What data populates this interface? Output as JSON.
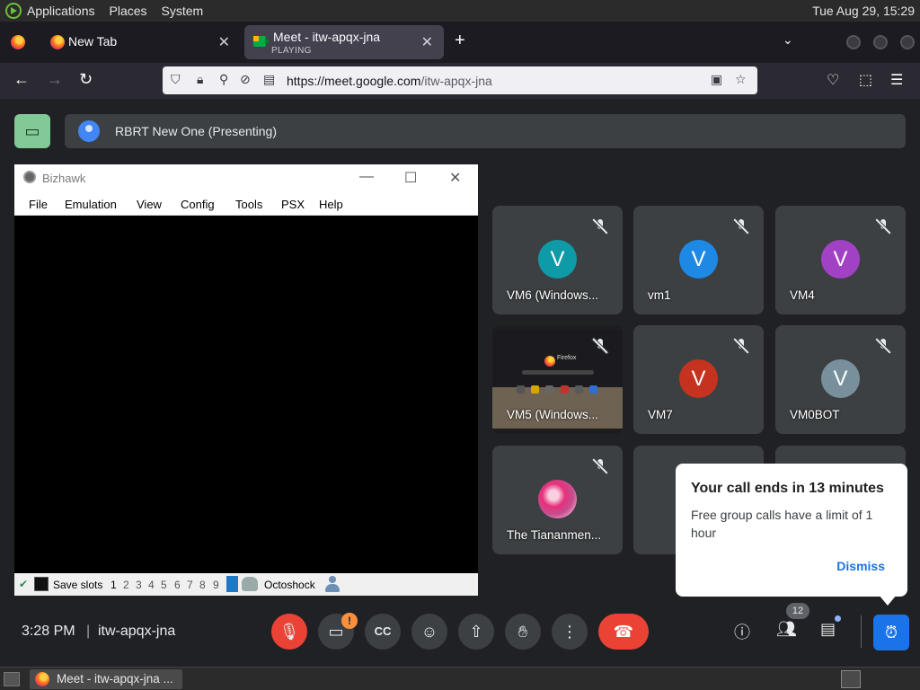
{
  "top_panel": {
    "menus": [
      "Applications",
      "Places",
      "System"
    ],
    "clock": "Tue Aug 29, 15:29"
  },
  "browser": {
    "tabs": [
      {
        "title": "New Tab",
        "subtitle": ""
      },
      {
        "title": "Meet - itw-apqx-jna",
        "subtitle": "PLAYING"
      }
    ],
    "url_domain_prefix": "https://meet.",
    "url_host": "google.com",
    "url_path": "/itw-apqx-jna"
  },
  "meet": {
    "presenter_label": "RBRT New One (Presenting)",
    "presented_window": {
      "title": "Bizhawk",
      "menu": [
        "File",
        "Emulation",
        "View",
        "Config",
        "Tools",
        "PSX",
        "Help"
      ],
      "status": {
        "save_slots_label": "Save slots",
        "slots": [
          "1",
          "2",
          "3",
          "4",
          "5",
          "6",
          "7",
          "8",
          "9"
        ],
        "core": "Octoshock"
      }
    },
    "participants": [
      {
        "name": "VM6 (Windows...",
        "initial": "V",
        "color": "#0f9aa8"
      },
      {
        "name": "vm1",
        "initial": "V",
        "color": "#1e88e5"
      },
      {
        "name": "VM4",
        "initial": "V",
        "color": "#a142c4"
      },
      {
        "name": "VM5 (Windows...",
        "initial": "",
        "color": ""
      },
      {
        "name": "VM7",
        "initial": "V",
        "color": "#c5321f"
      },
      {
        "name": "VM0BOT",
        "initial": "V",
        "color": "#78909c"
      },
      {
        "name": "The Tiananmen...",
        "initial": "",
        "color": ""
      }
    ],
    "screenshare_thumb_text": "Firefox",
    "popup": {
      "title": "Your call ends in 13 minutes",
      "body": "Free group calls have a limit of 1 hour",
      "dismiss": "Dismiss"
    },
    "controls": {
      "time": "3:28 PM",
      "separator": "|",
      "meeting_code": "itw-apqx-jna",
      "camera_warning": "!",
      "people_count": "12"
    }
  },
  "taskbar": {
    "task_label": "Meet - itw-apqx-jna ..."
  },
  "colors": {
    "meet_bg": "#202124",
    "tile_bg": "#3c4043",
    "end_call_red": "#ea4335",
    "accent_blue": "#1a73e8",
    "present_green": "#81c995"
  }
}
